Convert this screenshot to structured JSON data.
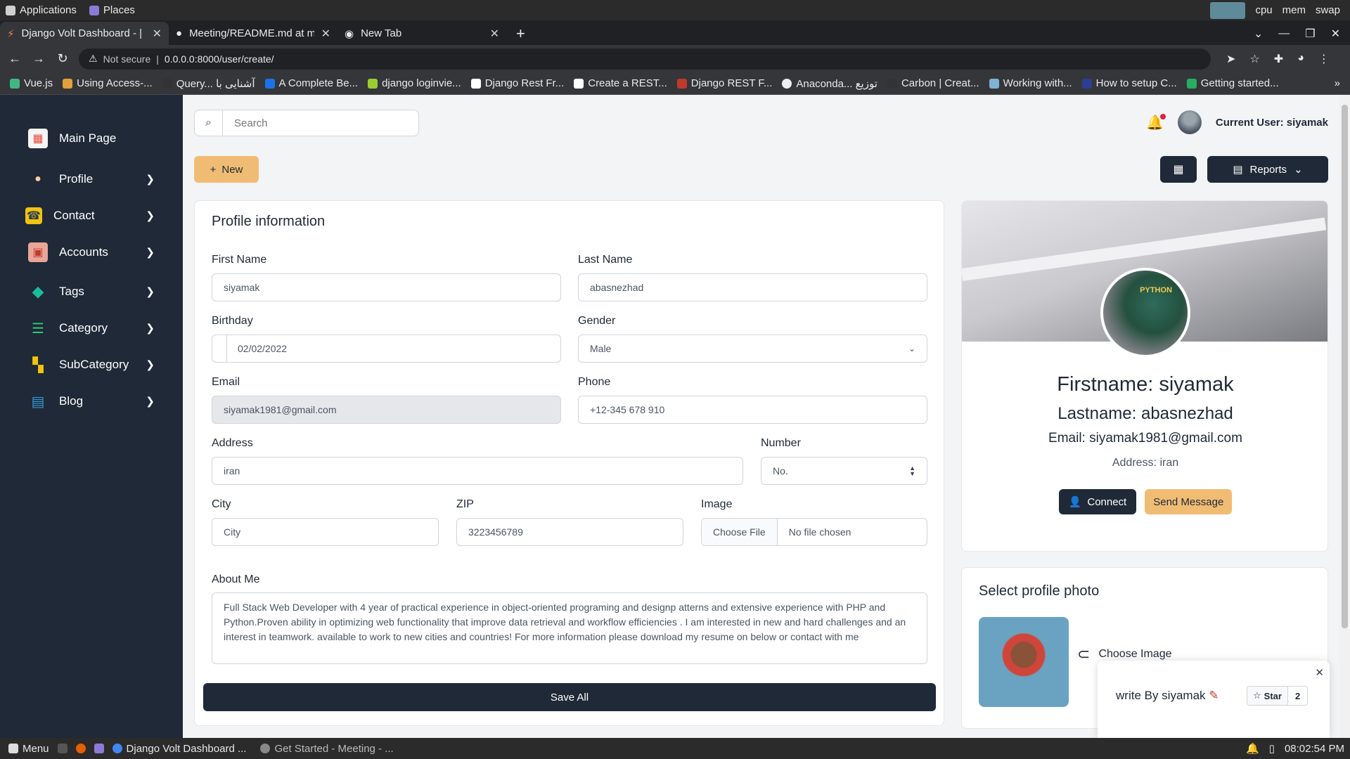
{
  "system": {
    "applications": "Applications",
    "places": "Places",
    "cpu": "cpu",
    "mem": "mem",
    "swap": "swap"
  },
  "tabs": [
    {
      "label": "Django Volt Dashboard - |"
    },
    {
      "label": "Meeting/README.md at m"
    },
    {
      "label": "New Tab"
    }
  ],
  "address": {
    "not_secure": "Not secure",
    "url": "0.0.0.0:8000/user/create/"
  },
  "bookmarks": [
    "Vue.js",
    "Using Access-...",
    "Query... آشنایی با",
    "A Complete Be...",
    "django loginvie...",
    "Django Rest Fr...",
    "Create a REST...",
    "Django REST F...",
    "Anaconda... توزیع",
    "Carbon | Creat...",
    "Working with...",
    "How to setup C...",
    "Getting started..."
  ],
  "sidebar": {
    "items": [
      {
        "label": "Main Page"
      },
      {
        "label": "Profile"
      },
      {
        "label": "Contact"
      },
      {
        "label": "Accounts"
      },
      {
        "label": "Tags"
      },
      {
        "label": "Category"
      },
      {
        "label": "SubCategory"
      },
      {
        "label": "Blog"
      }
    ]
  },
  "header": {
    "search_placeholder": "Search",
    "current_user": "Current User: siyamak",
    "new_label": "New",
    "reports_label": "Reports"
  },
  "form": {
    "title": "Profile information",
    "first_name_label": "First Name",
    "first_name": "siyamak",
    "last_name_label": "Last Name",
    "last_name": "abasnezhad",
    "birthday_label": "Birthday",
    "birthday": "02/02/2022",
    "gender_label": "Gender",
    "gender": "Male",
    "email_label": "Email",
    "email": "siyamak1981@gmail.com",
    "phone_label": "Phone",
    "phone": "+12-345 678 910",
    "address_label": "Address",
    "address": "iran",
    "number_label": "Number",
    "number_placeholder": "No.",
    "city_label": "City",
    "city_placeholder": "City",
    "zip_label": "ZIP",
    "zip": "3223456789",
    "image_label": "Image",
    "choose_file": "Choose File",
    "no_file": "No file chosen",
    "about_label": "About Me",
    "about": "Full Stack Web Developer with 4 year of practical experience in object-oriented programing and designp atterns and extensive experience with PHP and Python.Proven ability in optimizing web functionality that improve data retrieval and workflow efficiencies . I am interested in new and hard challenges and an interest in teamwork. available to work to new cities and countries! For more information please download my resume on below or contact with me",
    "save_label": "Save All"
  },
  "profile_card": {
    "avatar_text": "PYTHON",
    "firstname": "Firstname: siyamak",
    "lastname": "Lastname: abasnezhad",
    "email": "Email: siyamak1981@gmail.com",
    "address": "Address: iran",
    "connect_label": "Connect",
    "send_label": "Send Message"
  },
  "photo_card": {
    "title": "Select profile photo",
    "choose_label": "Choose Image"
  },
  "toast": {
    "text": "write By siyamak",
    "star_label": "Star",
    "star_count": "2"
  },
  "taskbar": {
    "menu": "Menu",
    "windows": [
      "Django Volt Dashboard ...",
      "Get Started - Meeting - ..."
    ],
    "clock": "08:02:54 PM"
  },
  "colors": {
    "sidebar": "#1f2937",
    "accent": "#f0bc74",
    "dark_button": "#1f2937"
  }
}
